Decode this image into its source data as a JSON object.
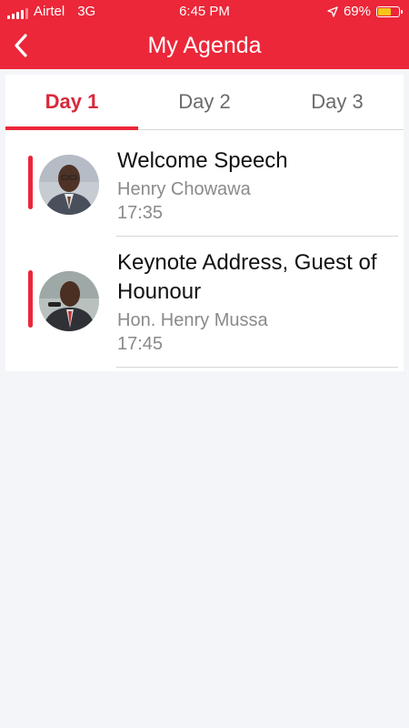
{
  "status_bar": {
    "carrier": "Airtel",
    "network": "3G",
    "time": "6:45 PM",
    "battery_percent": "69%",
    "battery_level": 0.69,
    "location_icon": "location-arrow-icon"
  },
  "header": {
    "title": "My Agenda",
    "back_icon": "chevron-left-icon"
  },
  "colors": {
    "brand": "#eb2739",
    "active_tab": "#d8293b",
    "muted_text": "#8a8a8a",
    "background": "#f4f5f9"
  },
  "tabs": [
    {
      "label": "Day 1",
      "active": true
    },
    {
      "label": "Day 2",
      "active": false
    },
    {
      "label": "Day 3",
      "active": false
    }
  ],
  "agenda": [
    {
      "title": "Welcome Speech",
      "speaker": "Henry Chowawa",
      "time": "17:35"
    },
    {
      "title": "Keynote Address, Guest of Hounour",
      "speaker": "Hon. Henry Mussa",
      "time": "17:45"
    }
  ]
}
